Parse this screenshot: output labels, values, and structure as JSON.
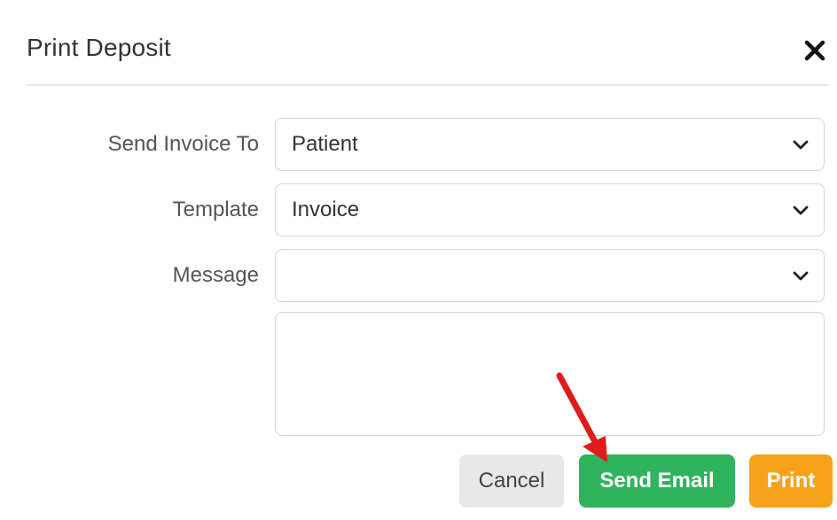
{
  "dialog": {
    "title": "Print Deposit",
    "close_icon": "close-icon"
  },
  "form": {
    "send_invoice_to": {
      "label": "Send Invoice To",
      "value": "Patient"
    },
    "template": {
      "label": "Template",
      "value": "Invoice"
    },
    "message": {
      "label": "Message",
      "value": ""
    },
    "message_body": {
      "value": ""
    }
  },
  "buttons": {
    "cancel": "Cancel",
    "send_email": "Send Email",
    "print": "Print"
  },
  "colors": {
    "send_email": "#2fb35c",
    "print": "#f7a21b",
    "cancel": "#e8e8e8",
    "annotation_arrow": "#e01b1b"
  },
  "annotation": {
    "icon": "red-arrow-icon",
    "points_to": "send-email-button"
  }
}
